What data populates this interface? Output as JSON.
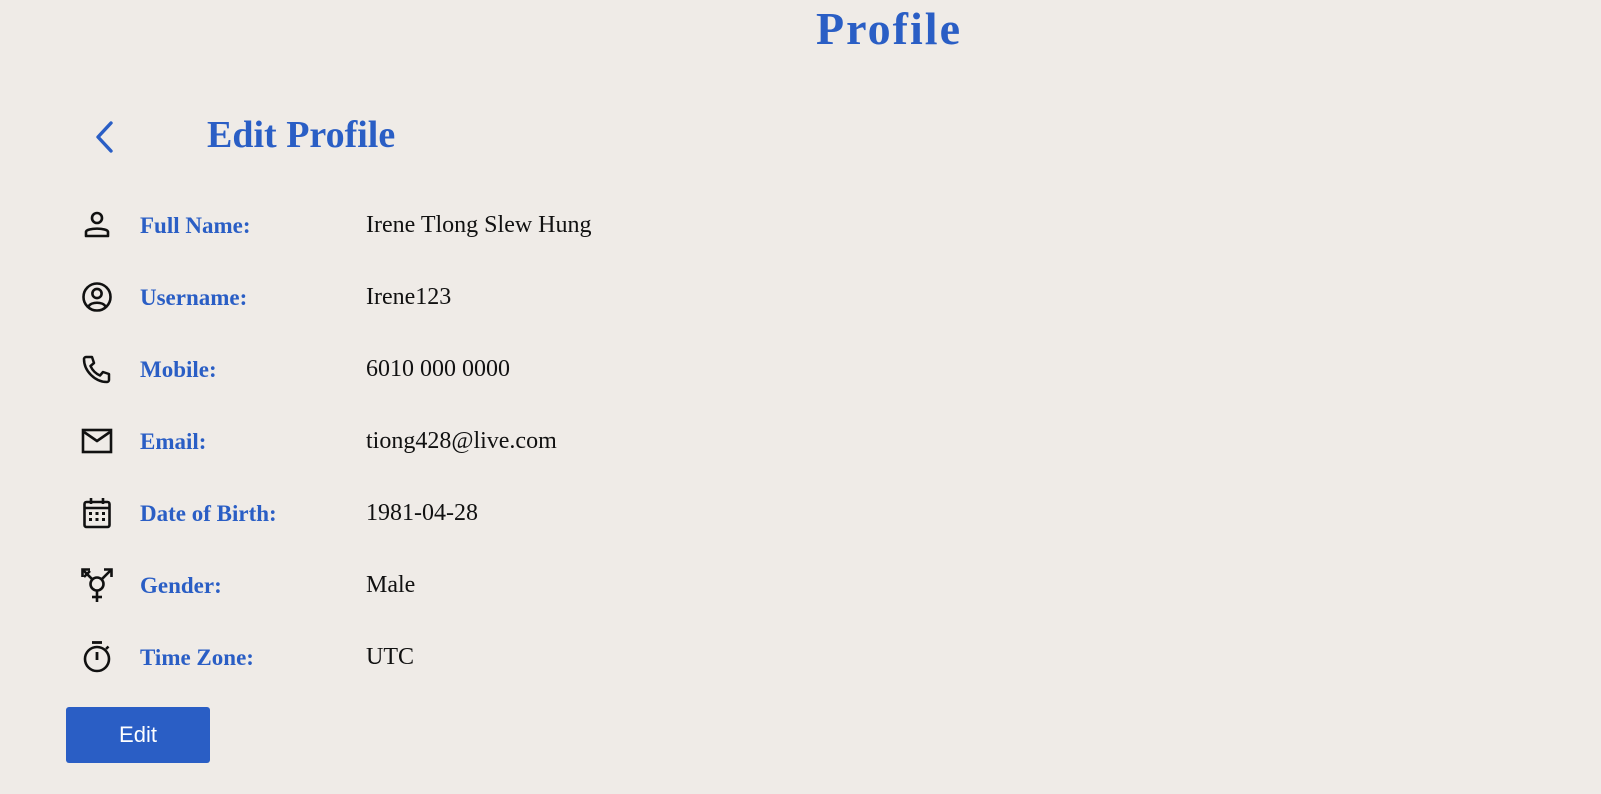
{
  "page": {
    "title": "Profile"
  },
  "section": {
    "title": "Edit Profile",
    "back_icon": "chevron-left-icon"
  },
  "fields": [
    {
      "icon": "person-icon",
      "label": "Full Name:",
      "value": "Irene Tlong Slew Hung"
    },
    {
      "icon": "account-circle-icon",
      "label": "Username:",
      "value": "Irene123"
    },
    {
      "icon": "phone-icon",
      "label": "Mobile:",
      "value": "6010 000 0000"
    },
    {
      "icon": "mail-icon",
      "label": "Email:",
      "value": "tiong428@live.com"
    },
    {
      "icon": "calendar-icon",
      "label": "Date of Birth:",
      "value": "1981-04-28"
    },
    {
      "icon": "transgender-icon",
      "label": "Gender:",
      "value": "Male"
    },
    {
      "icon": "timer-icon",
      "label": "Time Zone:",
      "value": "UTC"
    }
  ],
  "actions": {
    "edit_label": "Edit"
  },
  "colors": {
    "accent": "#2a5ec5",
    "background": "#efebe7",
    "text": "#111111"
  }
}
